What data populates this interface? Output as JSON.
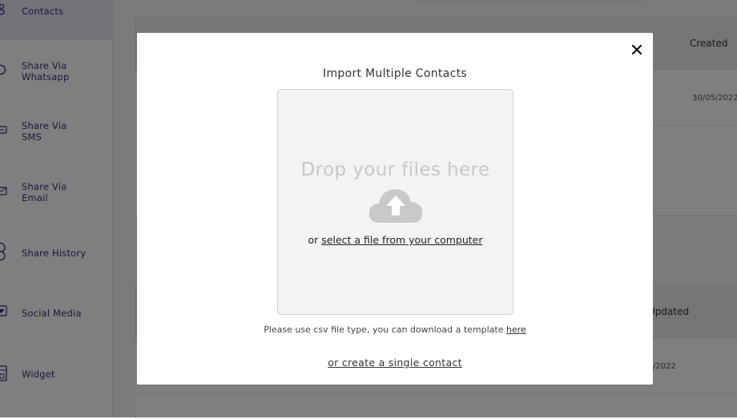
{
  "sidebar": {
    "items": [
      {
        "label": "Contacts",
        "icon": "contacts-icon"
      },
      {
        "label": "Share Via\nWhatsapp",
        "icon": "whatsapp-icon"
      },
      {
        "label": "Share Via\nSMS",
        "icon": "sms-icon"
      },
      {
        "label": "Share Via\nEmail",
        "icon": "email-icon"
      },
      {
        "label": "Share History",
        "icon": "history-icon"
      },
      {
        "label": "Social Media",
        "icon": "heart-icon"
      },
      {
        "label": "Widget",
        "icon": "widget-icon"
      }
    ]
  },
  "background": {
    "table1": {
      "header_created": "Created",
      "row_date": "30/05/2022"
    },
    "table2": {
      "header_updated": "Updated",
      "row_date": "/2022"
    }
  },
  "modal": {
    "title": "Import Multiple Contacts",
    "drop_text": "Drop your files here",
    "select_prefix": "or",
    "select_link": "select a file from your computer",
    "hint_text": "Please use csv file type, you can download a template",
    "hint_link": "here",
    "single_contact_link": "or create a single contact"
  },
  "colors": {
    "sidebar_text": "#2e2f86",
    "overlay": "rgba(0,0,0,0.5)",
    "cloud": "#c9c9c9"
  }
}
